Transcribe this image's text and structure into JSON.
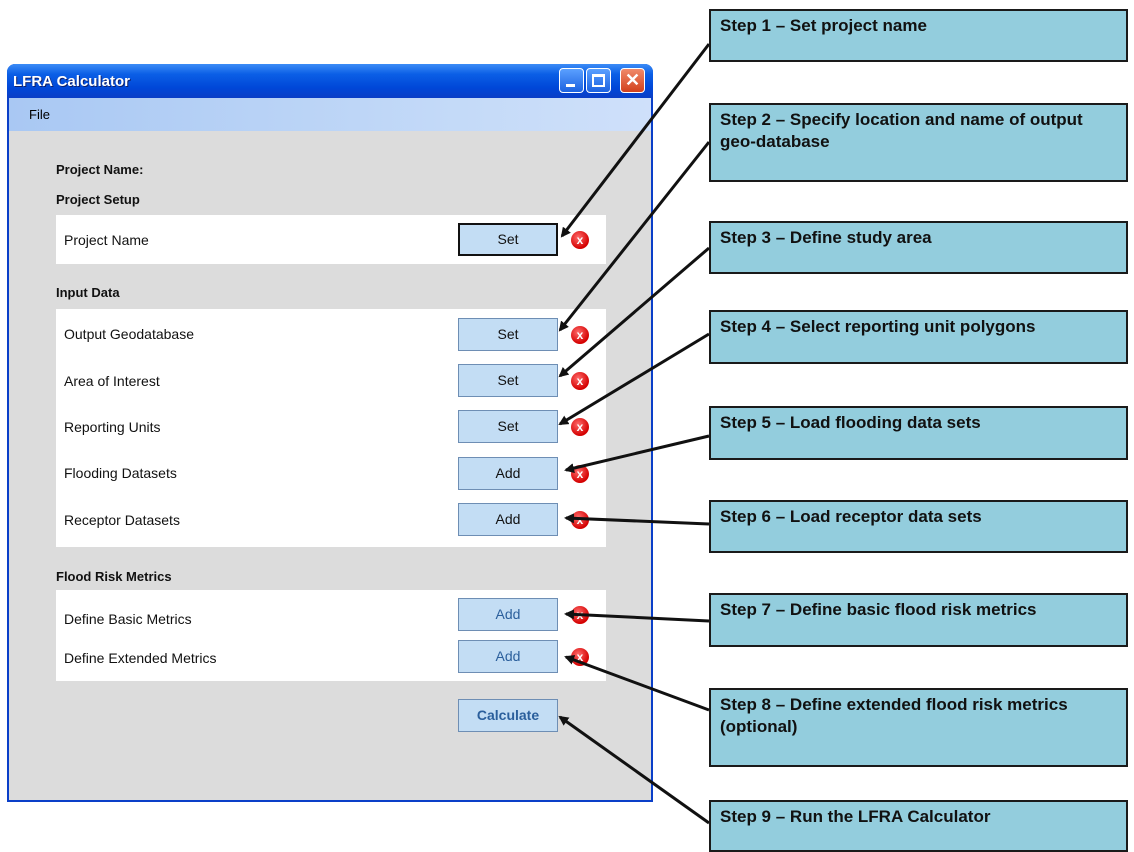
{
  "window": {
    "title": "LFRA Calculator",
    "menu": [
      "File"
    ],
    "close_glyph": "✕"
  },
  "main": {
    "project_name_label": "Project Name:",
    "sections": {
      "project_setup": {
        "heading": "Project Setup",
        "rows": [
          {
            "label": "Project Name",
            "button": "Set"
          }
        ]
      },
      "input_data": {
        "heading": "Input Data",
        "rows": [
          {
            "label": "Output Geodatabase",
            "button": "Set"
          },
          {
            "label": "Area of Interest",
            "button": "Set"
          },
          {
            "label": "Reporting Units",
            "button": "Set"
          },
          {
            "label": "Flooding Datasets",
            "button": "Add"
          },
          {
            "label": "Receptor Datasets",
            "button": "Add"
          }
        ]
      },
      "flood_risk_metrics": {
        "heading": "Flood Risk Metrics",
        "rows": [
          {
            "label": "Define Basic Metrics",
            "button": "Add"
          },
          {
            "label": "Define Extended Metrics",
            "button": "Add"
          }
        ]
      }
    },
    "calculate_button": "Calculate",
    "error_glyph": "x"
  },
  "callouts": [
    "Step 1 – Set project name",
    "Step 2 – Specify location and name of output geo-database",
    "Step 3 – Define study area",
    "Step 4 – Select reporting unit polygons",
    "Step 5 – Load flooding data sets",
    "Step 6 – Load receptor data sets",
    "Step 7 – Define basic flood risk metrics",
    "Step 8 – Define extended flood risk metrics (optional)",
    "Step 9 – Run the LFRA Calculator"
  ],
  "colors": {
    "titlebar": "#0b5fe6",
    "client_background": "#dcdcdc",
    "button_fill": "#c3ddf4",
    "callout_fill": "#93cddd",
    "error_icon": "#d40000"
  }
}
